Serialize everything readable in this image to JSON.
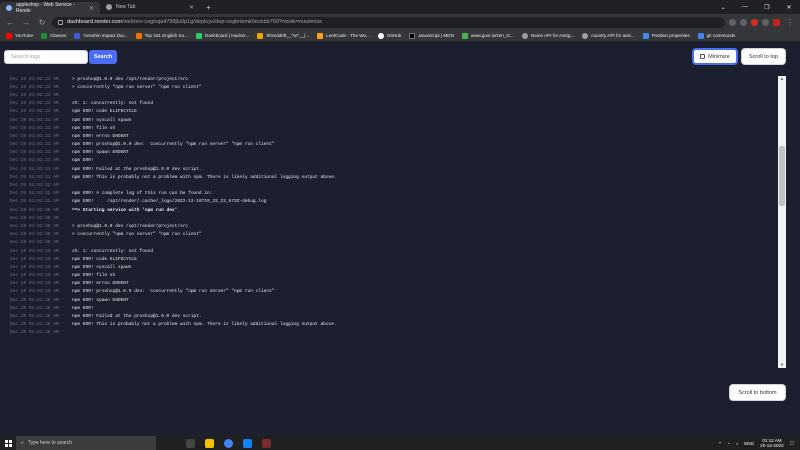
{
  "browser": {
    "tabs": [
      {
        "title": "appleshop - Web Service - Rende",
        "active": true
      },
      {
        "title": "New Tab",
        "active": false
      }
    ],
    "new_tab": "+",
    "url_host": "dashboard.render.com",
    "url_path": "/web/srv-cegbsja4798jlu0p1g/deploys/dep-cegbnbmk0ecbbb760?mode=maximize",
    "bookmarks": [
      {
        "label": "YouTube",
        "color": "#ff0000"
      },
      {
        "label": "Classes",
        "color": "#1e8e3e"
      },
      {
        "label": "Genshin Impact Dai...",
        "color": "#3b5bdb"
      },
      {
        "label": "Top 331 English So...",
        "color": "#e8710a"
      },
      {
        "label": "Dashboard | Hacker...",
        "color": "#2ec866"
      },
      {
        "label": "Shreddeft__^w^__|...",
        "color": "#f59f00"
      },
      {
        "label": "LeetCode - The Wo...",
        "color": "#ffa116"
      },
      {
        "label": "GitHub",
        "color": "#ffffff"
      },
      {
        "label": "JavaScript | MDN",
        "color": "#000000"
      },
      {
        "label": "www.guvi.io/zen_G...",
        "color": "#4caf50"
      },
      {
        "label": "Name API for Assig...",
        "color": "#9aa0a6"
      },
      {
        "label": "country API for assi...",
        "color": "#9aa0a6"
      },
      {
        "label": "Position properties",
        "color": "#4285f4"
      },
      {
        "label": "git commands",
        "color": "#4285f4"
      }
    ]
  },
  "search": {
    "placeholder": "Search logs",
    "button": "Search"
  },
  "buttons": {
    "minimize": "Minimize",
    "scroll_top": "Scroll to top",
    "scroll_bottom": "Scroll to bottom"
  },
  "logs": [
    {
      "ts": "Dec 20 01:02:21 AM",
      "msg": "> proshop@1.0.0 dev /opt/render/project/src",
      "bold": false
    },
    {
      "ts": "Dec 20 01:02:21 AM",
      "msg": "> concurrently \"npm run server\" \"npm run client\"",
      "bold": false
    },
    {
      "ts": "Dec 20 01:02:21 AM",
      "msg": "",
      "bold": false
    },
    {
      "ts": "Dec 20 01:02:21 AM",
      "msg": "sh: 1: concurrently: not found",
      "bold": false
    },
    {
      "ts": "Dec 20 01:02:21 AM",
      "msg": "npm ERR! code ELIFECYCLE",
      "bold": false
    },
    {
      "ts": "Dec 20 01:02:21 AM",
      "msg": "npm ERR! syscall spawn",
      "bold": false
    },
    {
      "ts": "Dec 20 01:02:21 AM",
      "msg": "npm ERR! file sh",
      "bold": false
    },
    {
      "ts": "Dec 20 01:02:21 AM",
      "msg": "npm ERR! errno ENOENT",
      "bold": false
    },
    {
      "ts": "Dec 20 01:02:21 AM",
      "msg": "npm ERR! proshop@1.0.0 dev: `concurrently \"npm run server\" \"npm run client\"`",
      "bold": false
    },
    {
      "ts": "Dec 20 01:02:21 AM",
      "msg": "npm ERR! spawn ENOENT",
      "bold": false
    },
    {
      "ts": "Dec 20 01:02:21 AM",
      "msg": "npm ERR!",
      "bold": false
    },
    {
      "ts": "Dec 20 01:02:21 AM",
      "msg": "npm ERR! Failed at the proshop@1.0.0 dev script.",
      "bold": false
    },
    {
      "ts": "Dec 20 01:02:21 AM",
      "msg": "npm ERR! This is probably not a problem with npm. There is likely additional logging output above.",
      "bold": false
    },
    {
      "ts": "Dec 20 01:02:22 AM",
      "msg": "",
      "bold": false
    },
    {
      "ts": "Dec 20 01:02:22 AM",
      "msg": "npm ERR! A complete log of this run can be found in:",
      "bold": false
    },
    {
      "ts": "Dec 20 01:02:22 AM",
      "msg": "npm ERR!     /opt/render/.cache/_logs/2022-12-19T19_32_22_073Z-debug.log",
      "bold": false
    },
    {
      "ts": "Dec 20 01:02:46 AM",
      "msg": "==> Starting service with 'npm run dev'",
      "bold": true
    },
    {
      "ts": "Dec 20 01:02:49 AM",
      "msg": "",
      "bold": false
    },
    {
      "ts": "Dec 20 01:02:49 AM",
      "msg": "> proshop@1.0.0 dev /opt/render/project/src",
      "bold": false
    },
    {
      "ts": "Dec 20 01:02:49 AM",
      "msg": "> concurrently \"npm run server\" \"npm run client\"",
      "bold": false
    },
    {
      "ts": "Dec 20 01:02:49 AM",
      "msg": "",
      "bold": false
    },
    {
      "ts": "Dec 20 01:02:49 AM",
      "msg": "sh: 1: concurrently: not found",
      "bold": false
    },
    {
      "ts": "Dec 20 01:02:49 AM",
      "msg": "npm ERR! code ELIFECYCLE",
      "bold": false
    },
    {
      "ts": "Dec 20 01:02:49 AM",
      "msg": "npm ERR! syscall spawn",
      "bold": false
    },
    {
      "ts": "Dec 20 01:02:49 AM",
      "msg": "npm ERR! file sh",
      "bold": false
    },
    {
      "ts": "Dec 20 01:02:49 AM",
      "msg": "npm ERR! errno ENOENT",
      "bold": false
    },
    {
      "ts": "Dec 20 01:02:49 AM",
      "msg": "npm ERR! proshop@1.0.0 dev: `concurrently \"npm run server\" \"npm run client\"`",
      "bold": false
    },
    {
      "ts": "Dec 20 01:02:49 AM",
      "msg": "npm ERR! spawn ENOENT",
      "bold": false
    },
    {
      "ts": "Dec 20 01:02:49 AM",
      "msg": "npm ERR!",
      "bold": false
    },
    {
      "ts": "Dec 20 01:02:49 AM",
      "msg": "npm ERR! Failed at the proshop@1.0.0 dev script.",
      "bold": false
    },
    {
      "ts": "Dec 20 01:02:49 AM",
      "msg": "npm ERR! This is probably not a problem with npm. There is likely additional logging output above.",
      "bold": false
    },
    {
      "ts": "Dec 20 01:02:49 AM",
      "msg": "",
      "bold": false
    }
  ],
  "taskbar": {
    "search_placeholder": "Type here to search",
    "lang": "ENG",
    "time": "01:12 AM",
    "date": "20-12-2022"
  },
  "colors": {
    "accent": "#4a6cf7",
    "page_bg": "#1b1f2e"
  }
}
